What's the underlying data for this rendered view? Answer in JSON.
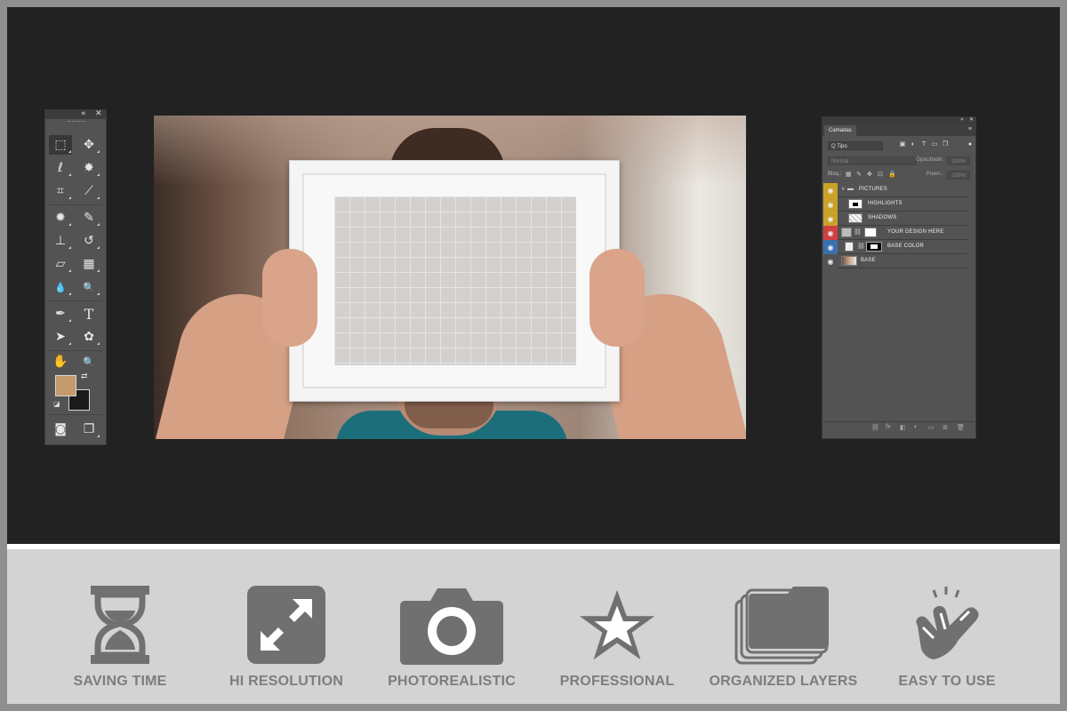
{
  "toolbox": {
    "collapse_glyph": "«",
    "close_glyph": "✕",
    "tools": [
      {
        "name": "rectangular-marquee-tool",
        "glyph": "⬚"
      },
      {
        "name": "move-tool",
        "glyph": "✥"
      },
      {
        "name": "lasso-tool",
        "glyph": "ℓ"
      },
      {
        "name": "magic-wand-tool",
        "glyph": "✸"
      },
      {
        "name": "crop-tool",
        "glyph": "⌗"
      },
      {
        "name": "eyedropper-tool",
        "glyph": "⟋"
      },
      {
        "name": "spot-healing-tool",
        "glyph": "✹"
      },
      {
        "name": "brush-tool",
        "glyph": "✎"
      },
      {
        "name": "clone-stamp-tool",
        "glyph": "⊥"
      },
      {
        "name": "history-brush-tool",
        "glyph": "↺"
      },
      {
        "name": "eraser-tool",
        "glyph": "▱"
      },
      {
        "name": "gradient-tool",
        "glyph": "▦"
      },
      {
        "name": "blur-tool",
        "glyph": "💧"
      },
      {
        "name": "dodge-tool",
        "glyph": "🔍"
      },
      {
        "name": "pen-tool",
        "glyph": "✒"
      },
      {
        "name": "type-tool",
        "glyph": "T"
      },
      {
        "name": "path-selection-tool",
        "glyph": "➤"
      },
      {
        "name": "custom-shape-tool",
        "glyph": "✿"
      },
      {
        "name": "hand-tool",
        "glyph": "✋"
      },
      {
        "name": "zoom-tool",
        "glyph": "🔍"
      }
    ],
    "foreground_color": "#c49a6c",
    "background_color": "#1a1a1a",
    "swap_glyph": "⇄",
    "default_glyph": "◪",
    "quick_mask_glyph": "◙",
    "screen_mode_glyph": "❐"
  },
  "layers_panel": {
    "collapse_glyph": "«",
    "close_glyph": "✕",
    "tab_label": "Camadas",
    "menu_glyph": "≡",
    "kind_filter": "Q Tipo",
    "blend_mode": "Normal",
    "opacity_label": "Opacidade:",
    "opacity_value": "100%",
    "lock_label": "Bloq.:",
    "fill_label": "Preen.:",
    "fill_value": "100%",
    "layers": [
      {
        "name": "PICTURES",
        "eye_color": "#c9a227",
        "kind": "group"
      },
      {
        "name": "HIGHLIGHTS",
        "eye_color": "#c9a227",
        "kind": "layer"
      },
      {
        "name": "SHADOWS",
        "eye_color": "#c9a227",
        "kind": "layer"
      },
      {
        "name": "YOUR DESIGN HERE",
        "eye_color": "#d04040",
        "kind": "smart"
      },
      {
        "name": "BASE COLOR",
        "eye_color": "#3a6fb0",
        "kind": "layer"
      },
      {
        "name": "BASE",
        "eye_color": "#535353",
        "kind": "image"
      }
    ],
    "footer_icons": [
      "⛓",
      "fx",
      "◧",
      "◐",
      "▭",
      "⊞",
      "🗑"
    ]
  },
  "features": [
    {
      "icon": "hourglass-icon",
      "label": "SAVING TIME"
    },
    {
      "icon": "expand-icon",
      "label": "HI RESOLUTION"
    },
    {
      "icon": "camera-icon",
      "label": "PHOTOREALISTIC"
    },
    {
      "icon": "star-icon",
      "label": "PROFESSIONAL"
    },
    {
      "icon": "stacked-folders-icon",
      "label": "ORGANIZED LAYERS"
    },
    {
      "icon": "tap-hand-icon",
      "label": "EASY TO USE"
    }
  ],
  "colors": {
    "workspace": "#222222",
    "panel": "#535353",
    "feature_icon": "#707070",
    "feature_text": "#7d7d7d"
  }
}
